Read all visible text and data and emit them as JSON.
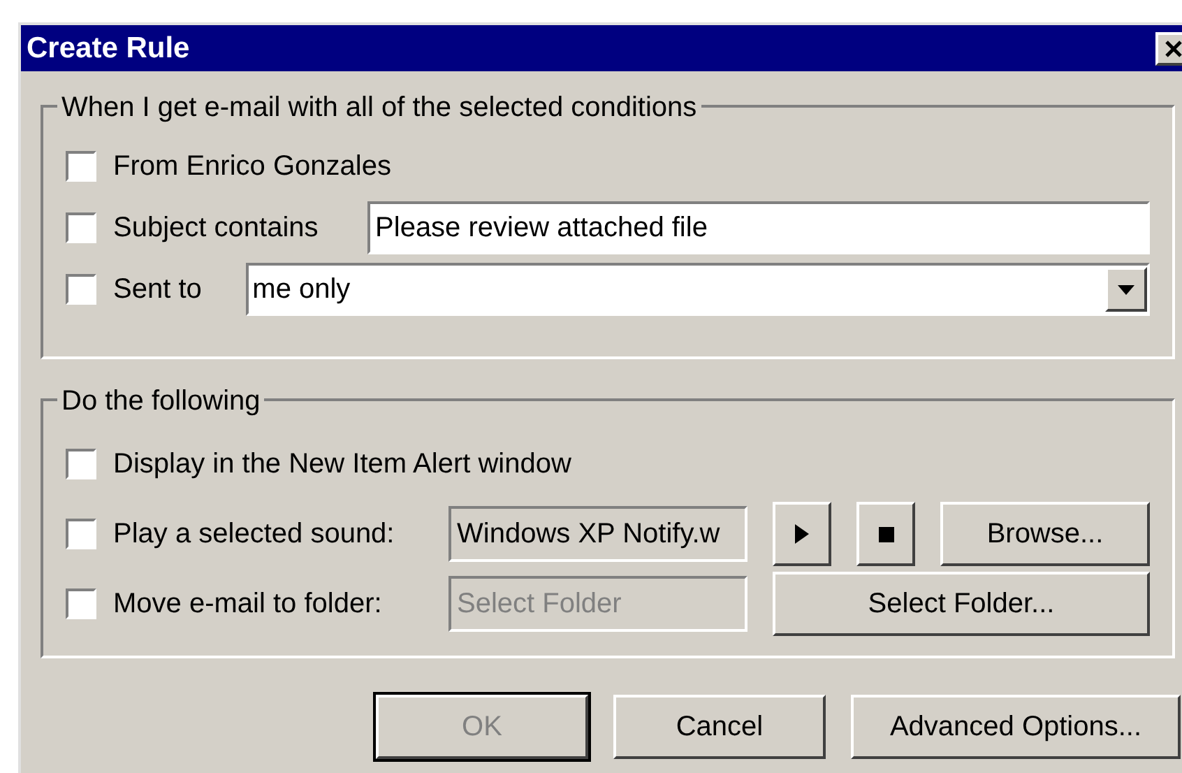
{
  "window": {
    "title": "Create Rule"
  },
  "conditions": {
    "legend": "When I get e-mail with all of the selected conditions",
    "items": [
      {
        "kind": "plain",
        "label": "From Enrico Gonzales",
        "checked": false
      },
      {
        "kind": "text",
        "label": "Subject contains",
        "checked": false,
        "value": "Please review attached file"
      },
      {
        "kind": "dropdown",
        "label": "Sent to",
        "checked": false,
        "value": "me only"
      }
    ]
  },
  "actions": {
    "legend": "Do the following",
    "items": [
      {
        "kind": "plain",
        "label": "Display in the New Item Alert window",
        "checked": false
      },
      {
        "kind": "sound",
        "label": "Play a selected sound:",
        "checked": false,
        "value": "Windows XP Notify.w",
        "button": "Browse..."
      },
      {
        "kind": "folder",
        "label": "Move e-mail to folder:",
        "checked": false,
        "placeholder": "Select Folder",
        "disabled": true,
        "button": "Select Folder..."
      }
    ]
  },
  "buttons": [
    {
      "label": "OK",
      "disabled": true,
      "default": true
    },
    {
      "label": "Cancel",
      "disabled": false,
      "default": false
    },
    {
      "label": "Advanced Options...",
      "disabled": false,
      "default": false
    }
  ]
}
